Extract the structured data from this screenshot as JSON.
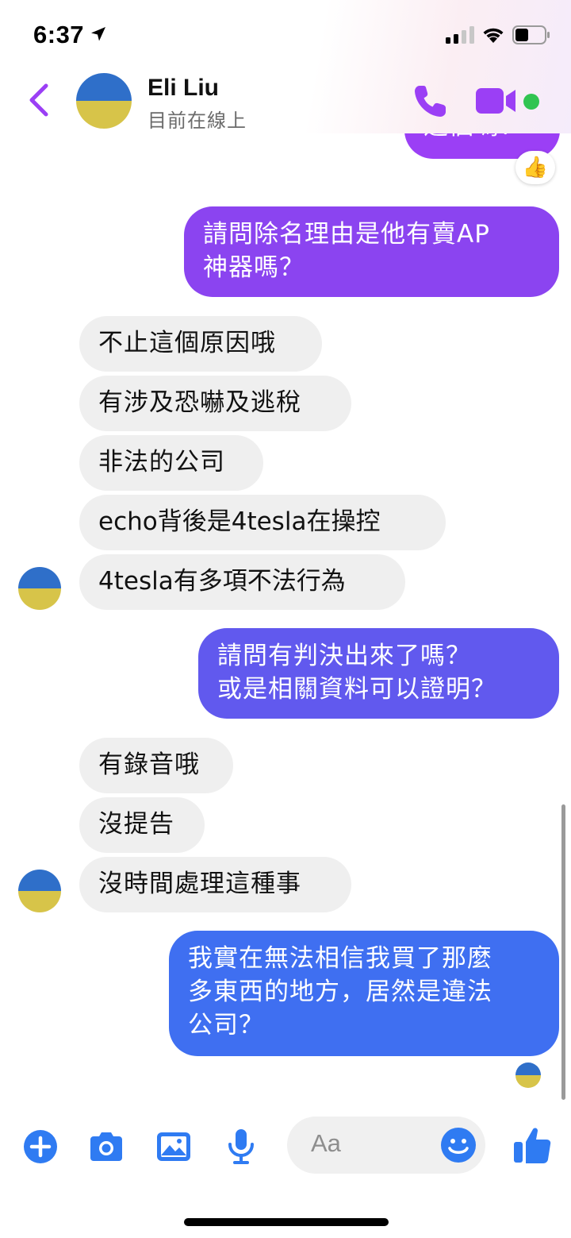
{
  "status_bar": {
    "time": "6:37"
  },
  "header": {
    "contact_name": "Eli Liu",
    "contact_status": "目前在線上",
    "icons": [
      "back-chevron-icon",
      "phone-icon",
      "video-camera-icon"
    ]
  },
  "messages": [
    {
      "side": "out",
      "text": "這個嗎？",
      "reaction": "👍"
    },
    {
      "side": "out",
      "text": "請問除名理由是他有賣AP\n神器嗎？"
    },
    {
      "side": "in",
      "text": "不止這個原因哦"
    },
    {
      "side": "in",
      "text": "有涉及恐嚇及逃稅"
    },
    {
      "side": "in",
      "text": "非法的公司"
    },
    {
      "side": "in",
      "text": "echo背後是4tesla在操控"
    },
    {
      "side": "in",
      "text": "4tesla有多項不法行為"
    },
    {
      "side": "out",
      "text": "請問有判決出來了嗎？\n或是相關資料可以證明？"
    },
    {
      "side": "in",
      "text": "有錄音哦"
    },
    {
      "side": "in",
      "text": "沒提告"
    },
    {
      "side": "in",
      "text": "沒時間處理這種事"
    },
    {
      "side": "out",
      "text": "我實在無法相信我買了那麼\n多東西的地方，居然是違法\n公司？"
    }
  ],
  "composer": {
    "placeholder": "Aa",
    "icons": [
      "plus-icon",
      "camera-icon",
      "image-icon",
      "microphone-icon",
      "emoji-icon",
      "thumbs-up-icon"
    ]
  },
  "colors": {
    "accent_purple": "#9b3ff5",
    "bubble_purple": "#8b44f0",
    "bubble_indigo": "#6159ee",
    "bubble_blue": "#3f6ff1",
    "messenger_blue": "#2f7bf2",
    "incoming_bg": "#efefef",
    "online_green": "#31c451"
  }
}
